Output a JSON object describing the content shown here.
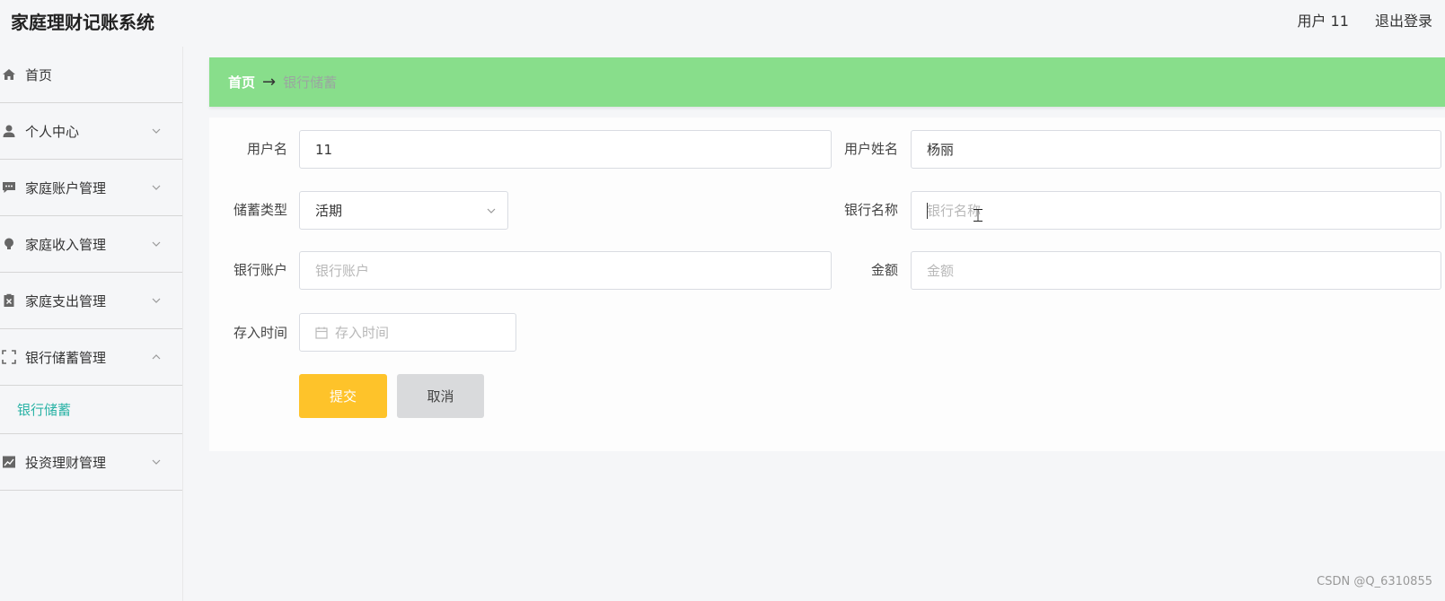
{
  "header": {
    "title": "家庭理财记账系统",
    "user_label": "用户 11",
    "logout_label": "退出登录"
  },
  "sidebar": {
    "items": [
      {
        "label": "首页",
        "icon": "home-icon"
      },
      {
        "label": "个人中心",
        "icon": "user-icon"
      },
      {
        "label": "家庭账户管理",
        "icon": "message-icon"
      },
      {
        "label": "家庭收入管理",
        "icon": "bulb-icon"
      },
      {
        "label": "家庭支出管理",
        "icon": "clipboard-x-icon"
      },
      {
        "label": "银行储蓄管理",
        "icon": "fullscreen-icon"
      },
      {
        "label": "投资理财管理",
        "icon": "chart-icon"
      }
    ],
    "active_sub": "银行储蓄"
  },
  "breadcrumb": {
    "home": "首页",
    "arrow": "→",
    "current": "银行储蓄"
  },
  "form": {
    "username_label": "用户名",
    "username_value": "11",
    "realname_label": "用户姓名",
    "realname_value": "杨丽",
    "savings_type_label": "储蓄类型",
    "savings_type_value": "活期",
    "bank_name_label": "银行名称",
    "bank_name_placeholder": "银行名称",
    "bank_account_label": "银行账户",
    "bank_account_placeholder": "银行账户",
    "amount_label": "金额",
    "amount_placeholder": "金额",
    "deposit_time_label": "存入时间",
    "deposit_time_placeholder": "存入时间",
    "submit_label": "提交",
    "cancel_label": "取消"
  },
  "colors": {
    "breadcrumb_bg": "#88de8b",
    "submit_bg": "#fec32a",
    "cancel_bg": "#d9dadc",
    "active_sub": "#2bb3a6"
  },
  "watermark": "CSDN @Q_6310855"
}
